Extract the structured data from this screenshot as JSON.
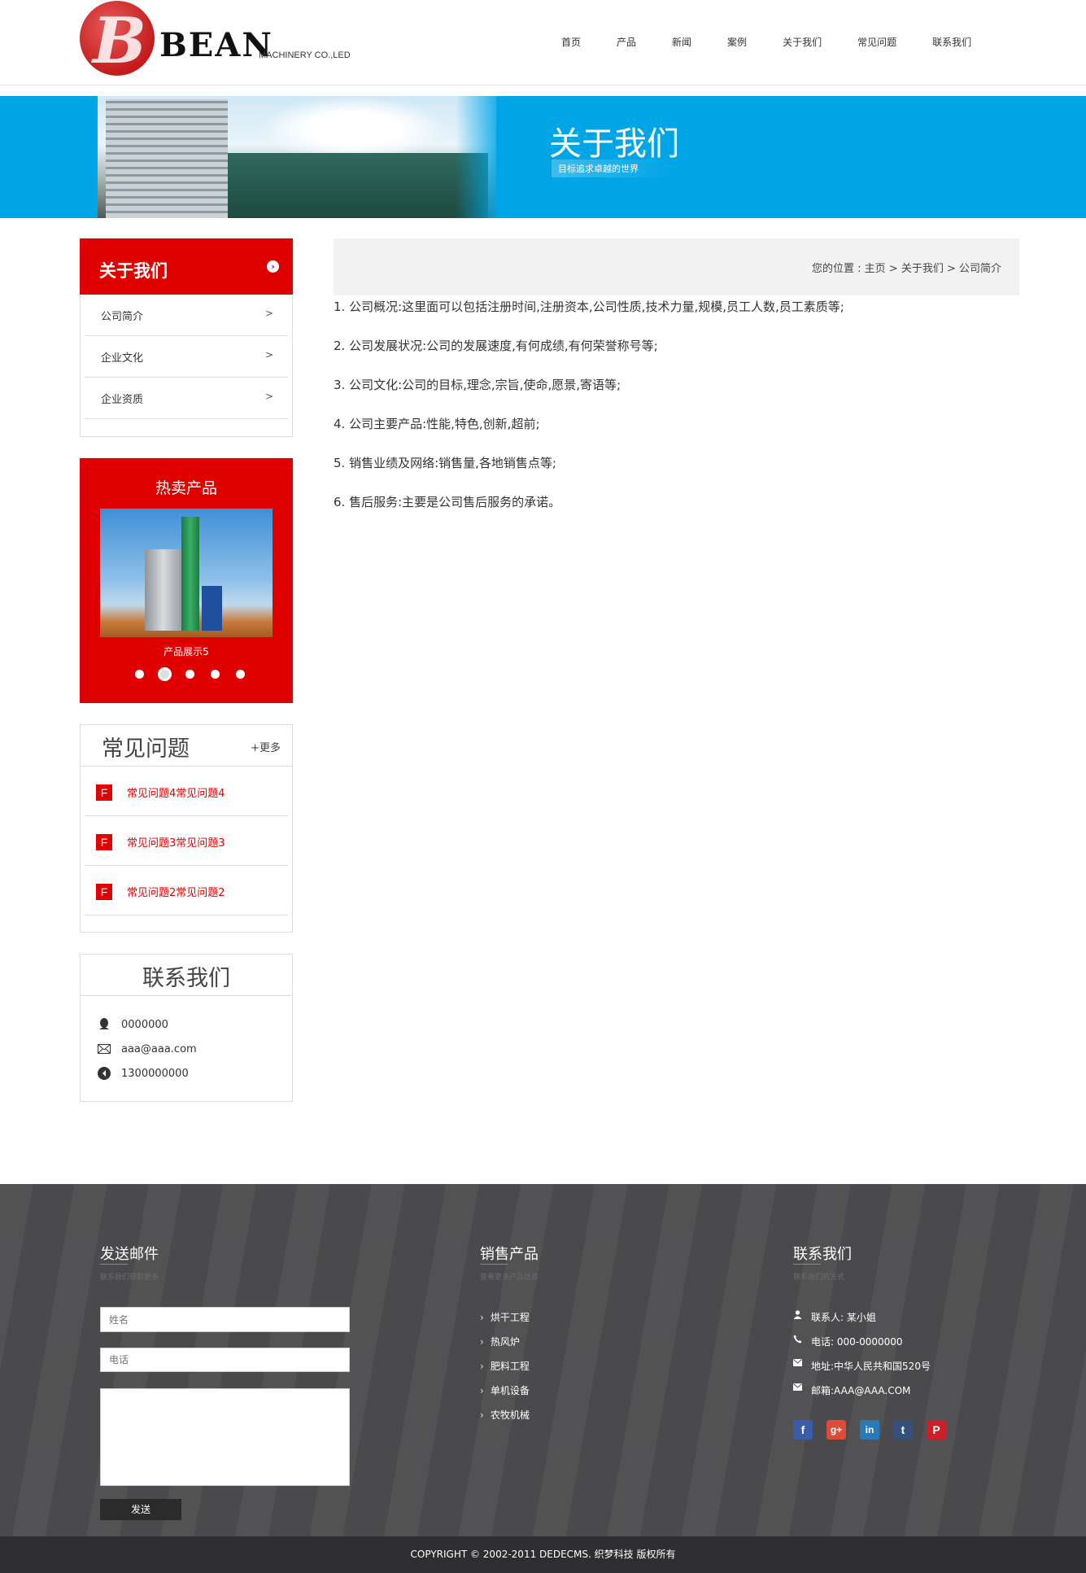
{
  "header": {
    "logo_letter": "B",
    "logo_word": "BEAN",
    "logo_sub": "MACHINERY CO.,LED",
    "nav": [
      "首页",
      "产品",
      "新闻",
      "案例",
      "关于我们",
      "常见问题",
      "联系我们"
    ]
  },
  "banner": {
    "title": "关于我们",
    "subtitle": "目标追求卓越的世界"
  },
  "sidebar": {
    "about_title": "关于我们",
    "about_items": [
      {
        "label": "公司简介",
        "arrow": ">"
      },
      {
        "label": "企业文化",
        "arrow": ">"
      },
      {
        "label": "企业资质",
        "arrow": ">"
      }
    ],
    "hot_title": "热卖产品",
    "hot_caption": "产品展示5",
    "hot_slides_total": 5,
    "hot_slide_active": 2,
    "faq_title": "常见问题",
    "faq_more": "+更多",
    "faq_badge": "F",
    "faq_items": [
      "常见问题4常见问题4",
      "常见问题3常见问题3",
      "常见问题2常见问题2"
    ],
    "contact_title": "联系我们",
    "contact_qq": "0000000",
    "contact_email": "aaa@aaa.com",
    "contact_phone": "1300000000"
  },
  "main": {
    "breadcrumb": "您的位置 : 主页 > 关于我们 > 公司简介",
    "paragraphs": [
      "1. 公司概况:这里面可以包括注册时间,注册资本,公司性质,技术力量,规模,员工人数,员工素质等;",
      "2. 公司发展状况:公司的发展速度,有何成绩,有何荣誉称号等;",
      "3. 公司文化:公司的目标,理念,宗旨,使命,愿景,寄语等;",
      "4. 公司主要产品:性能,特色,创新,超前;",
      "5. 销售业绩及网络:销售量,各地销售点等;",
      "6. 售后服务:主要是公司售后服务的承诺。"
    ]
  },
  "footer": {
    "mail_title": "发送邮件",
    "mail_sub": "联系我们获取更多",
    "name_placeholder": "姓名",
    "phone_placeholder": "电话",
    "send_label": "发送",
    "products_title": "销售产品",
    "products_sub": "查看更多产品信息",
    "products": [
      "烘干工程",
      "热风炉",
      "肥料工程",
      "单机设备",
      "农牧机械"
    ],
    "contact_title": "联系我们",
    "contact_sub": "联系我们的方式",
    "contact_person": "联系人: 某小姐",
    "contact_tel": "电话: 000-0000000",
    "contact_addr": "地址:中华人民共和国520号",
    "contact_mail": "邮箱:AAA@AAA.COM",
    "social": [
      {
        "name": "facebook-icon",
        "glyph": "f",
        "color": "#3b5ca8"
      },
      {
        "name": "google-plus-icon",
        "glyph": "g+",
        "color": "#dd4b39"
      },
      {
        "name": "linkedin-icon",
        "glyph": "in",
        "color": "#2a7ab8"
      },
      {
        "name": "tumblr-icon",
        "glyph": "t",
        "color": "#35507a"
      },
      {
        "name": "pinterest-icon",
        "glyph": "P",
        "color": "#cb2027"
      }
    ],
    "copyright": "COPYRIGHT © 2002-2011 DEDECMS. 织梦科技 版权所有"
  }
}
